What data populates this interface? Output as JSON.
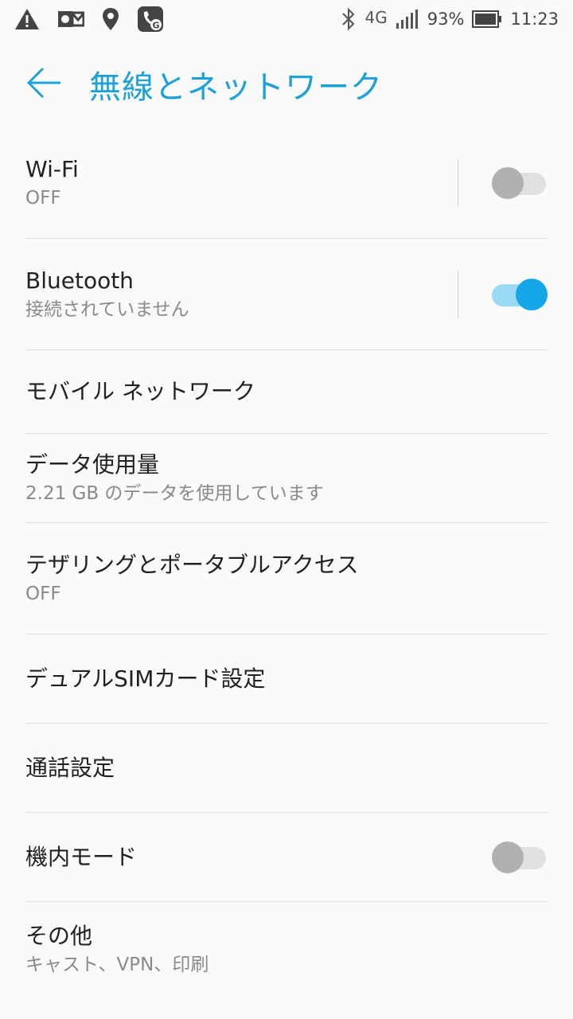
{
  "status_bar": {
    "network": "4G",
    "battery": "93%",
    "time": "11:23"
  },
  "header": {
    "title": "無線とネットワーク"
  },
  "settings": [
    {
      "title": "Wi-Fi",
      "subtitle": "OFF",
      "toggle": "off"
    },
    {
      "title": "Bluetooth",
      "subtitle": "接続されていません",
      "toggle": "on"
    },
    {
      "title": "モバイル ネットワーク"
    },
    {
      "title": "データ使用量",
      "subtitle": "2.21 GB のデータを使用しています"
    },
    {
      "title": "テザリングとポータブルアクセス",
      "subtitle": "OFF"
    },
    {
      "title": "デュアルSIMカード設定"
    },
    {
      "title": "通話設定"
    },
    {
      "title": "機内モード",
      "toggle": "off"
    },
    {
      "title": "その他",
      "subtitle": "キャスト、VPN、印刷"
    }
  ],
  "colors": {
    "accent": "#1ea1d8",
    "toggle_on": "#14a7e8"
  },
  "icons": [
    "warning-icon",
    "voicemail-icon",
    "location-icon",
    "call-app-icon",
    "bluetooth-icon",
    "signal-icon",
    "battery-icon",
    "back-arrow-icon"
  ]
}
